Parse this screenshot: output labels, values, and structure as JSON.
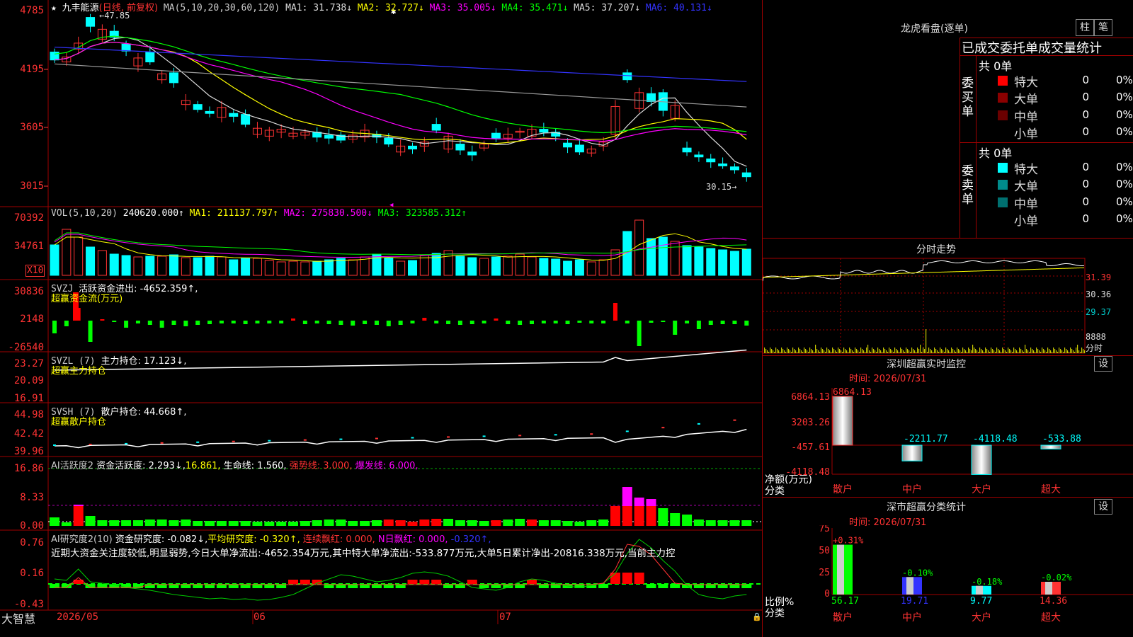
{
  "stock": {
    "name": "九丰能源",
    "period": "(日线, 前复权)",
    "star": "★"
  },
  "price_header": {
    "ma_label": "MA(5,10,20,30,60,120)",
    "items": [
      {
        "text": "MA1: 31.738↓",
        "color": "#dddddd"
      },
      {
        "text": "MA2: 32.727↓",
        "color": "#ffff00"
      },
      {
        "text": "MA3: 35.005↓",
        "color": "#ff00ff"
      },
      {
        "text": "MA4: 35.471↓",
        "color": "#00ff00"
      },
      {
        "text": "MA5: 37.207↓",
        "color": "#dddddd"
      },
      {
        "text": "MA6: 40.131↓",
        "color": "#3333ff"
      }
    ],
    "high_mark": "47.85",
    "low_mark": "30.15"
  },
  "price_axis": [
    "4785",
    "4195",
    "3605",
    "3015"
  ],
  "vol_header": {
    "label": "VOL(5,10,20)",
    "value": "240620.000↑",
    "ma1": "MA1: 211137.797↑",
    "ma2": "MA2: 275830.500↓",
    "ma3": "MA3: 323585.312↑"
  },
  "vol_axis": [
    "70392",
    "34761"
  ],
  "vol_unit": "X10",
  "svzj": {
    "title": "SVZJ",
    "label": "活跃资金进出: -4652.359↑,",
    "sub": "超赢资金流(万元)",
    "axis": [
      "30836",
      "2148",
      "-26540"
    ]
  },
  "svzl": {
    "title": "SVZL  (7)",
    "label": "主力持仓: 17.123↓,",
    "sub": "超赢主力持仓",
    "axis": [
      "23.27",
      "20.09",
      "16.91"
    ]
  },
  "svsh": {
    "title": "SVSH  (7)",
    "label": "散户持仓: 44.668↑,",
    "sub": "超赢散户持仓",
    "axis": [
      "44.98",
      "42.42",
      "39.96"
    ]
  },
  "ai1": {
    "title": "AI活跃度2",
    "label": "资金活跃度: 2.293↓,",
    "v2": "16.861,",
    "v3": "生命线: 1.560,",
    "v4": "强势线: 3.000,",
    "v5": "爆发线: 6.000,",
    "axis": [
      "16.86",
      "8.33",
      "0.00"
    ]
  },
  "ai2": {
    "title": "AI研究度2(10)",
    "label": "资金研究度: -0.082↓,",
    "v2": "平均研究度: -0.320↑,",
    "v3": "连续飘红: 0.000,",
    "v4": "N日飘红: 0.000,",
    "v5": "-0.320↑,",
    "text": "近期大资金关注度较低,明显弱势,今日大单净流出:-4652.354万元,其中特大单净流出:-533.877万元,大单5日累计净出-20816.338万元,当前主力控",
    "axis": [
      "0.76",
      "0.16",
      "-0.43"
    ]
  },
  "footer": {
    "brand": "大智慧",
    "dates": [
      "2026/05",
      "06",
      "07"
    ]
  },
  "right": {
    "lhkp": "龙虎看盘(逐单)",
    "btn_zhu": "柱",
    "btn_bi": "笔",
    "stat_title": "已成交委托单成交量统计",
    "buy_side": {
      "label": "委买单",
      "total": "共 0单",
      "rows": [
        {
          "name": "特大",
          "color": "#ff0000",
          "count": "0",
          "pct": "0%"
        },
        {
          "name": "大单",
          "color": "#8b0000",
          "count": "0",
          "pct": "0%"
        },
        {
          "name": "中单",
          "color": "#6b0000",
          "count": "0",
          "pct": "0%"
        },
        {
          "name": "小单",
          "color": "#000000",
          "count": "0",
          "pct": "0%"
        }
      ]
    },
    "sell_side": {
      "label": "委卖单",
      "total": "共 0单",
      "rows": [
        {
          "name": "特大",
          "color": "#00ffff",
          "count": "0",
          "pct": "0%"
        },
        {
          "name": "大单",
          "color": "#008b8b",
          "count": "0",
          "pct": "0%"
        },
        {
          "name": "中单",
          "color": "#007070",
          "count": "0",
          "pct": "0%"
        },
        {
          "name": "小单",
          "color": "#000000",
          "count": "0",
          "pct": "0%"
        }
      ]
    },
    "fszs": {
      "title": "分时走势",
      "axis": [
        "31.39",
        "30.36",
        "29.37",
        "8888",
        "分时"
      ]
    },
    "sz_monitor": {
      "title": "深圳超赢实时监控",
      "btn": "设",
      "time": "时间: 2026/07/31",
      "axis": [
        "6864.13",
        "3203.26",
        "-457.61",
        "-4118.48"
      ],
      "unit": "净额(万元)",
      "cat_label": "分类",
      "categories": [
        "散户",
        "中户",
        "大户",
        "超大"
      ],
      "values": [
        6864.13,
        -2211.77,
        -4118.48,
        -533.88
      ],
      "value_labels": [
        "6864.13",
        "-2211.77",
        "-4118.48",
        "-533.88"
      ]
    },
    "sz_class": {
      "title": "深市超赢分类统计",
      "btn": "设",
      "time": "时间: 2026/07/31",
      "axis": [
        "75",
        "50",
        "25",
        "0"
      ],
      "unit": "比例%",
      "cat_label": "分类",
      "categories": [
        "散户",
        "中户",
        "大户",
        "超大"
      ],
      "values": [
        56.17,
        19.71,
        9.77,
        14.36
      ],
      "changes": [
        "+0.31%",
        "-0.10%",
        "-0.18%",
        "-0.02%"
      ],
      "value_labels": [
        "56.17",
        "19.71",
        "9.77",
        "14.36"
      ]
    }
  }
}
